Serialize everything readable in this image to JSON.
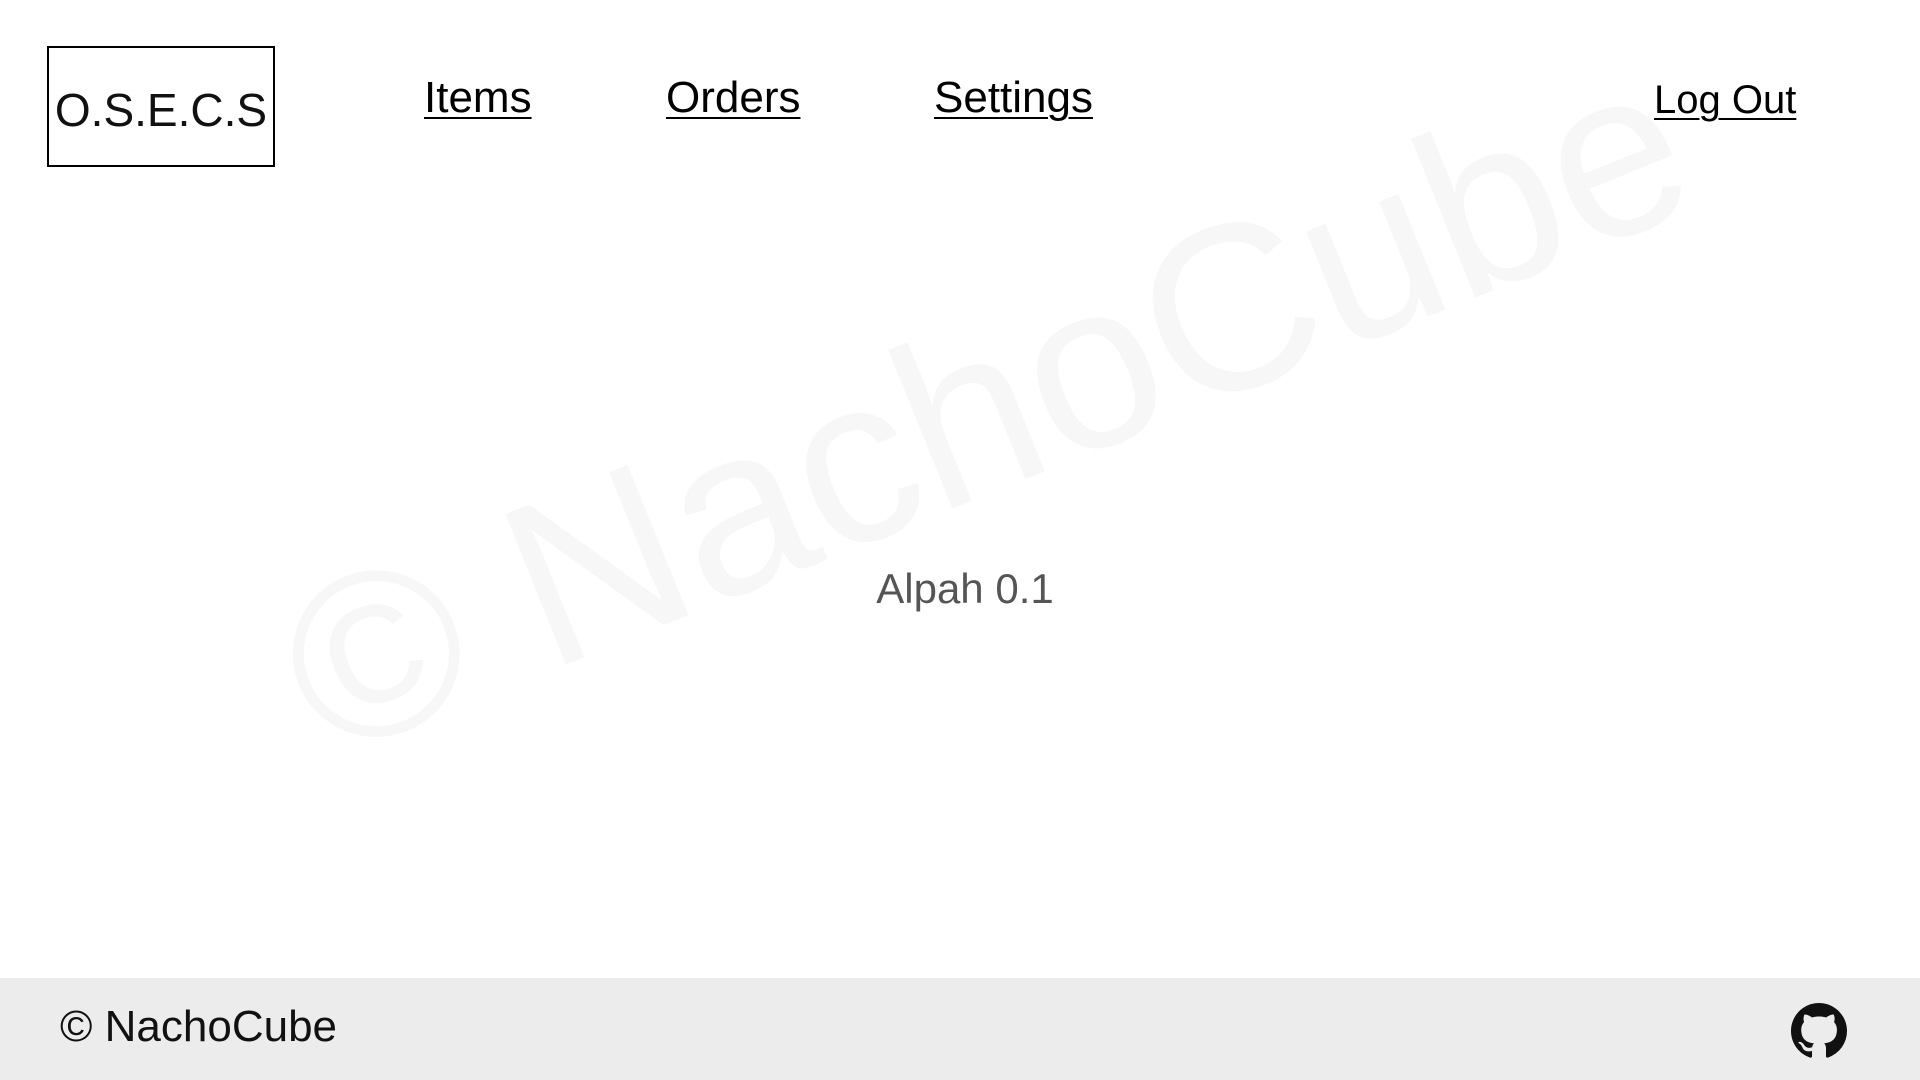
{
  "header": {
    "logo_text": "O.S.E.C.S",
    "nav": {
      "items_label": "Items",
      "orders_label": "Orders",
      "settings_label": "Settings"
    },
    "logout_label": "Log Out"
  },
  "main": {
    "watermark": "© NachoCube",
    "version_text": "Alpah 0.1"
  },
  "footer": {
    "copyright": "© NachoCube",
    "github_icon": "github-icon"
  },
  "colors": {
    "background": "#ffffff",
    "footer_background": "#ececec",
    "text": "#000000",
    "version_text": "#555555"
  }
}
